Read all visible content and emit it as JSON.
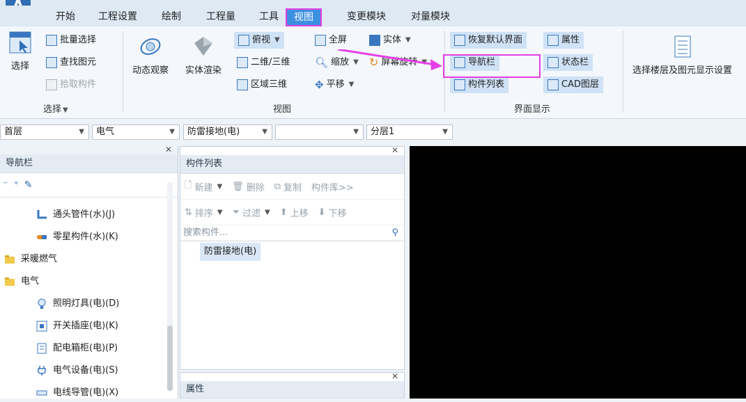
{
  "app": {
    "logo_letter": "A"
  },
  "tabs": [
    "开始",
    "工程设置",
    "绘制",
    "工程量",
    "工具",
    "视图",
    "变更模块",
    "对量模块"
  ],
  "active_tab": "视图",
  "ribbon": {
    "select_group": {
      "select": "选择",
      "batch_select": "批量选择",
      "find_element": "查找图元",
      "pick_component": "拾取构件",
      "label": "选择"
    },
    "view_group": {
      "dynamic_observe": "动态观察",
      "solid_render": "实体渲染",
      "top_view": "俯视",
      "2d3d": "二维/三维",
      "region_3d": "区域三维",
      "fullscreen": "全屏",
      "zoom": "缩放",
      "pan": "平移",
      "solid": "实体",
      "screen_rotate": "屏幕旋转",
      "label": "视图"
    },
    "ui_group": {
      "restore_default": "恢复默认界面",
      "properties": "属性",
      "navbar": "导航栏",
      "statusbar": "状态栏",
      "component_list": "构件列表",
      "cad_layer": "CAD图层",
      "label": "界面显示"
    },
    "layer_display": "选择楼层及图元显示设置"
  },
  "filters": {
    "floor": "首层",
    "discipline": "电气",
    "type": "防雷接地(电)",
    "empty": "",
    "sublayer": "分层1"
  },
  "nav": {
    "title": "导航栏",
    "items": [
      {
        "label": "通头管件(水)(J)",
        "icon": "pipe-fitting-icon"
      },
      {
        "label": "零星构件(水)(K)",
        "icon": "misc-component-icon"
      },
      {
        "label": "采暖燃气",
        "icon": "folder-icon"
      },
      {
        "label": "电气",
        "icon": "folder-open-icon"
      },
      {
        "label": "照明灯具(电)(D)",
        "icon": "lightbulb-icon"
      },
      {
        "label": "开关插座(电)(K)",
        "icon": "switch-socket-icon"
      },
      {
        "label": "配电箱柜(电)(P)",
        "icon": "distribution-box-icon"
      },
      {
        "label": "电气设备(电)(S)",
        "icon": "plug-icon"
      },
      {
        "label": "电线导管(电)(X)",
        "icon": "conduit-icon"
      }
    ]
  },
  "complist": {
    "title": "构件列表",
    "new": "新建",
    "delete": "删除",
    "copy": "复制",
    "library": "构件库>>",
    "sort": "排序",
    "filter": "过滤",
    "move_up": "上移",
    "move_down": "下移",
    "search_placeholder": "搜索构件...",
    "items": [
      "防雷接地(电)"
    ]
  },
  "props": {
    "title": "属性"
  },
  "colors": {
    "accent": "#3d8fe0",
    "highlight": "#e63ee6",
    "canvas": "#000000"
  }
}
